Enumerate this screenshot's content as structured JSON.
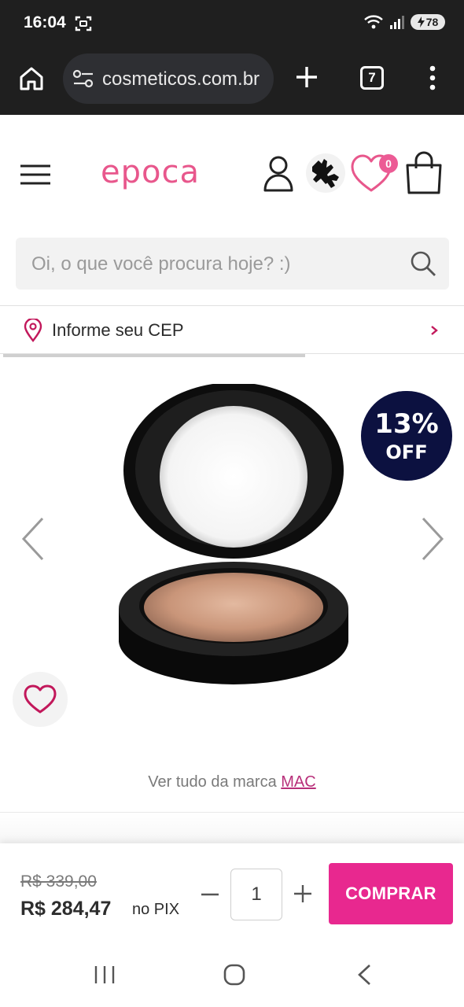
{
  "status_bar": {
    "time": "16:04",
    "battery": "78",
    "icons": [
      "screenshot-icon",
      "wifi-icon",
      "signal-icon",
      "battery-charging-icon"
    ]
  },
  "browser": {
    "url": "cosmeticos.com.br",
    "tab_count": "7",
    "icons": [
      "home-icon",
      "site-settings-icon",
      "new-tab-icon",
      "more-vert-icon"
    ]
  },
  "header": {
    "logo": "epoca",
    "wishlist_count": "0",
    "icons": [
      "menu-icon",
      "user-icon",
      "libras-hands-icon",
      "heart-icon",
      "shopping-bag-icon"
    ]
  },
  "search": {
    "placeholder": "Oi, o que você procura hoje? :)"
  },
  "cep": {
    "label": "Informe seu CEP"
  },
  "product": {
    "discount_value": "13%",
    "discount_label": "OFF",
    "brand_prefix": "Ver tudo da marca ",
    "brand": "MAC",
    "carousel_progress": 0.65
  },
  "buy_bar": {
    "old_price": "R$ 339,00",
    "new_price": "R$ 284,47",
    "pix_label": "no PIX",
    "quantity": "1",
    "buy_label": "COMPRAR"
  },
  "colors": {
    "brand_pink": "#e8578c",
    "buy_button": "#e8288f",
    "badge_navy": "#0c1140",
    "brand_link": "#b8307a"
  }
}
